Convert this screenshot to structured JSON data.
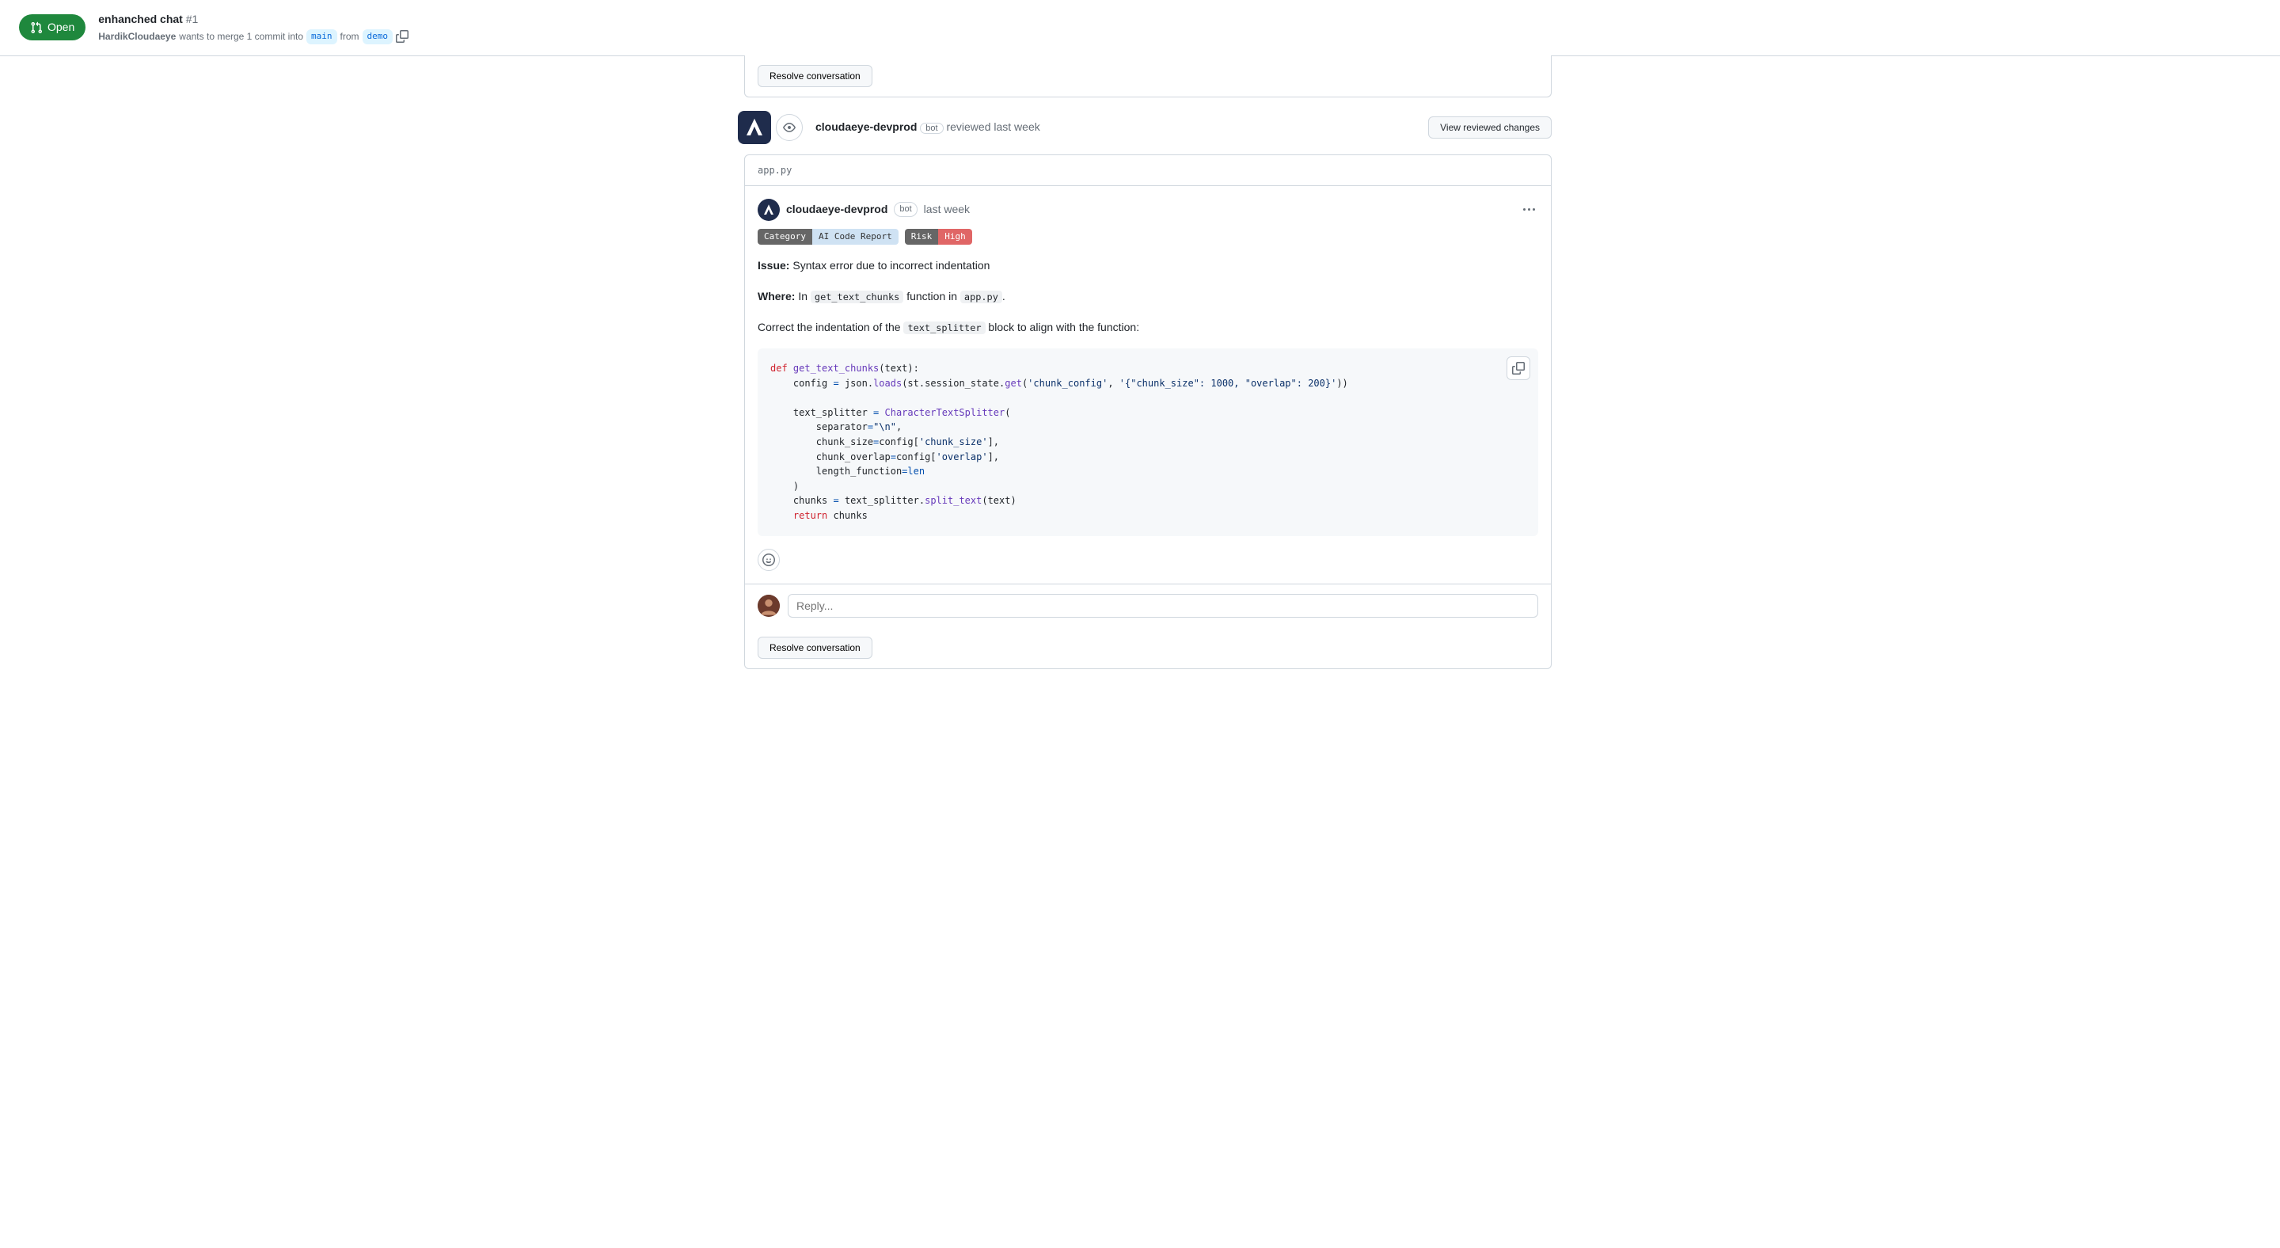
{
  "header": {
    "status_label": "Open",
    "pr_title": "enhanched chat",
    "pr_number": "#1",
    "merge_author": "HardikCloudaeye",
    "merge_text_mid": " wants to merge 1 commit into ",
    "merge_base": "main",
    "merge_text_from": " from ",
    "merge_head": "demo"
  },
  "resolve_top": "Resolve conversation",
  "review": {
    "author": "cloudaeye-devprod",
    "bot_label": "bot",
    "reviewed_text": " reviewed ",
    "timestamp": "last week",
    "view_changes": "View reviewed changes"
  },
  "file_path": "app.py",
  "comment": {
    "author": "cloudaeye-devprod",
    "bot_label": "bot",
    "timestamp": "last week",
    "category_key": "Category",
    "category_val": "AI Code Report",
    "risk_key": "Risk",
    "risk_val": "High",
    "issue_label": "Issue:",
    "issue_text": " Syntax error due to incorrect indentation",
    "where_label": "Where:",
    "where_text_1": " In ",
    "where_code_1": "get_text_chunks",
    "where_text_2": " function in ",
    "where_code_2": "app.py",
    "where_text_3": ".",
    "correct_pre": "Correct the indentation of the ",
    "correct_code": "text_splitter",
    "correct_post": " block to align with the function:"
  },
  "code": {
    "l1_kw": "def",
    "l1_fn": " get_text_chunks",
    "l1_rest": "(text):",
    "l2_a": "    config ",
    "l2_eq": "=",
    "l2_b": " json.",
    "l2_fn": "loads",
    "l2_c": "(st.session_state.",
    "l2_fn2": "get",
    "l2_d": "(",
    "l2_s1": "'chunk_config'",
    "l2_d2": ", ",
    "l2_s2": "'{\"chunk_size\": 1000, \"overlap\": 200}'",
    "l2_d3": "))",
    "l4_a": "    text_splitter ",
    "l4_eq": "=",
    "l4_fn": " CharacterTextSplitter",
    "l4_b": "(",
    "l5_a": "        separator",
    "l5_eq": "=",
    "l5_s": "\"\\n\"",
    "l5_c": ",",
    "l6_a": "        chunk_size",
    "l6_eq": "=",
    "l6_b": "config[",
    "l6_s": "'chunk_size'",
    "l6_c": "],",
    "l7_a": "        chunk_overlap",
    "l7_eq": "=",
    "l7_b": "config[",
    "l7_s": "'overlap'",
    "l7_c": "],",
    "l8_a": "        length_function",
    "l8_eq": "=",
    "l8_b": "len",
    "l9": "    )",
    "l10_a": "    chunks ",
    "l10_eq": "=",
    "l10_b": " text_splitter.",
    "l10_fn": "split_text",
    "l10_c": "(text)",
    "l11_kw": "    return",
    "l11_b": " chunks"
  },
  "reply": {
    "placeholder": "Reply..."
  },
  "resolve_bottom": "Resolve conversation"
}
